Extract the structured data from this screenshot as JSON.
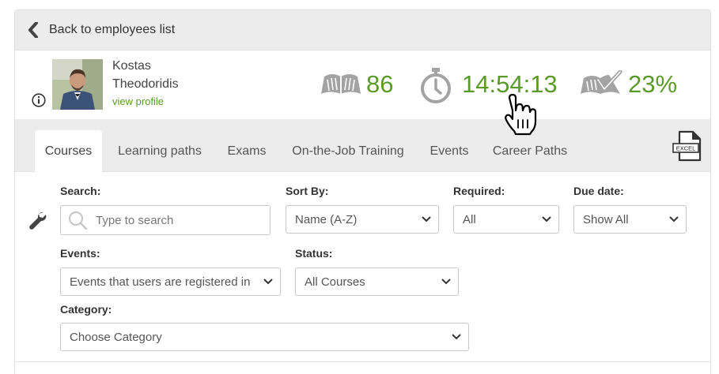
{
  "back": {
    "label": "Back to employees list"
  },
  "employee": {
    "first_name": "Kostas",
    "last_name": "Theodoridis",
    "view_profile": "view profile"
  },
  "stats": {
    "courses": "86",
    "time": "14:54:13",
    "completion": "23%"
  },
  "tabs": [
    {
      "label": "Courses",
      "active": true
    },
    {
      "label": "Learning paths"
    },
    {
      "label": "Exams"
    },
    {
      "label": "On-the-Job Training"
    },
    {
      "label": "Events"
    },
    {
      "label": "Career Paths"
    }
  ],
  "export": {
    "icon": "excel-export-icon",
    "badge": "EXCEL"
  },
  "filters": {
    "search": {
      "label": "Search:",
      "placeholder": "Type to search"
    },
    "sort_by": {
      "label": "Sort By:",
      "value": "Name (A-Z)"
    },
    "required": {
      "label": "Required:",
      "value": "All"
    },
    "due_date": {
      "label": "Due date:",
      "value": "Show All"
    },
    "events": {
      "label": "Events:",
      "value": "Events that users are registered in"
    },
    "status": {
      "label": "Status:",
      "value": "All Courses"
    },
    "category": {
      "label": "Category:",
      "value": "Choose Category"
    }
  },
  "colors": {
    "accent_green": "#5a9a2a",
    "icon_gray": "#9a9a9a",
    "bar_gray": "#ececec"
  }
}
